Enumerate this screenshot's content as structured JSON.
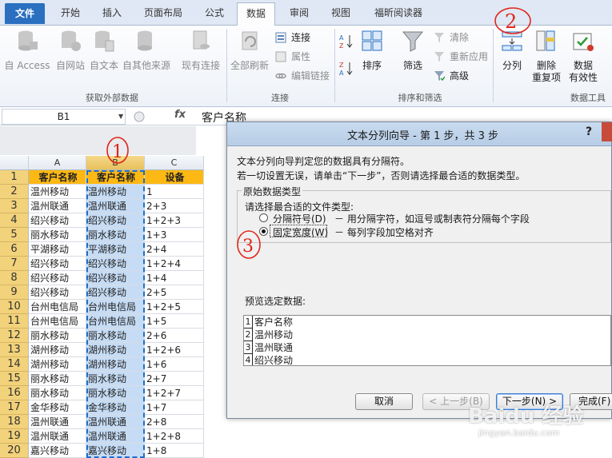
{
  "ribbon": {
    "tabs": [
      {
        "label": "文件"
      },
      {
        "label": "开始"
      },
      {
        "label": "插入"
      },
      {
        "label": "页面布局"
      },
      {
        "label": "公式"
      },
      {
        "label": "数据"
      },
      {
        "label": "审阅"
      },
      {
        "label": "视图"
      },
      {
        "label": "福昕阅读器"
      }
    ],
    "active_tab": "数据",
    "groups": {
      "external": {
        "label": "获取外部数据",
        "buttons": [
          "自 Access",
          "自网站",
          "自文本",
          "自其他来源",
          "现有连接"
        ]
      },
      "connections": {
        "label": "连接",
        "refresh_all": "全部刷新",
        "items": [
          "连接",
          "属性",
          "编辑链接"
        ]
      },
      "sort_filter": {
        "label": "排序和筛选",
        "sort": "排序",
        "filter": "筛选",
        "items": [
          "清除",
          "重新应用",
          "高级"
        ]
      },
      "data_tools": {
        "label": "数据工具",
        "split": "分列",
        "dedupe_line1": "删除",
        "dedupe_line2": "重复项",
        "validate_line1": "数据",
        "validate_line2": "有效性"
      }
    },
    "icon_colors": {
      "accent": "#2a6fc0",
      "filter": "#7a7a7a",
      "check": "#2e9b3a",
      "error": "#d03a2a"
    }
  },
  "formula_bar": {
    "name_box": "B1",
    "fx": "fx",
    "content": "客户名称"
  },
  "sheet": {
    "columns": [
      "A",
      "B",
      "C"
    ],
    "rows": [
      {
        "n": "1",
        "a": "客户名称",
        "b": "客户名称",
        "c": "设备"
      },
      {
        "n": "2",
        "a": "温州移动",
        "b": "温州移动",
        "c": "1"
      },
      {
        "n": "3",
        "a": "温州联通",
        "b": "温州联通",
        "c": "2+3"
      },
      {
        "n": "4",
        "a": "绍兴移动",
        "b": "绍兴移动",
        "c": "1+2+3"
      },
      {
        "n": "5",
        "a": "丽水移动",
        "b": "丽水移动",
        "c": "1+3"
      },
      {
        "n": "6",
        "a": "平湖移动",
        "b": "平湖移动",
        "c": "2+4"
      },
      {
        "n": "7",
        "a": "绍兴移动",
        "b": "绍兴移动",
        "c": "1+2+4"
      },
      {
        "n": "8",
        "a": "绍兴移动",
        "b": "绍兴移动",
        "c": "1+4"
      },
      {
        "n": "9",
        "a": "绍兴移动",
        "b": "绍兴移动",
        "c": "2+5"
      },
      {
        "n": "10",
        "a": "台州电信局",
        "b": "台州电信局",
        "c": "1+2+5"
      },
      {
        "n": "11",
        "a": "台州电信局",
        "b": "台州电信局",
        "c": "1+5"
      },
      {
        "n": "12",
        "a": "丽水移动",
        "b": "丽水移动",
        "c": "2+6"
      },
      {
        "n": "13",
        "a": "湖州移动",
        "b": "湖州移动",
        "c": "1+2+6"
      },
      {
        "n": "14",
        "a": "湖州移动",
        "b": "湖州移动",
        "c": "1+6"
      },
      {
        "n": "15",
        "a": "丽水移动",
        "b": "丽水移动",
        "c": "2+7"
      },
      {
        "n": "16",
        "a": "丽水移动",
        "b": "丽水移动",
        "c": "1+2+7"
      },
      {
        "n": "17",
        "a": "金华移动",
        "b": "金华移动",
        "c": "1+7"
      },
      {
        "n": "18",
        "a": "温州联通",
        "b": "温州联通",
        "c": "2+8"
      },
      {
        "n": "19",
        "a": "温州联通",
        "b": "温州联通",
        "c": "1+2+8"
      },
      {
        "n": "20",
        "a": "嘉兴移动",
        "b": "嘉兴移动",
        "c": "1+8"
      }
    ]
  },
  "dialog": {
    "title": "文本分列向导 - 第 1 步，共 3 步",
    "help": "?",
    "intro1": "文本分列向导判定您的数据具有分隔符。",
    "intro2": "若一切设置无误，请单击“下一步”，否则请选择最合适的数据类型。",
    "group_title": "原始数据类型",
    "prompt": "请选择最合适的文件类型:",
    "options": [
      {
        "label": "分隔符号(D)",
        "desc": "－ 用分隔字符，如逗号或制表符分隔每个字段",
        "selected": false
      },
      {
        "label": "固定宽度(W)",
        "desc": "－ 每列字段加空格对齐",
        "selected": true
      }
    ],
    "preview_label": "预览选定数据:",
    "preview_rows": [
      {
        "n": "1",
        "text": "客户名称"
      },
      {
        "n": "2",
        "text": "温州移动"
      },
      {
        "n": "3",
        "text": "温州联通"
      },
      {
        "n": "4",
        "text": "绍兴移动"
      }
    ],
    "buttons": {
      "cancel": "取消",
      "back": "< 上一步(B)",
      "next": "下一步(N) >",
      "finish": "完成(F)"
    }
  },
  "annotations": {
    "color": "#e0261b",
    "marks": [
      "1",
      "2",
      "3"
    ]
  },
  "watermark": {
    "main": "Baidu 经验",
    "sub": "jingyan.baidu.com"
  }
}
